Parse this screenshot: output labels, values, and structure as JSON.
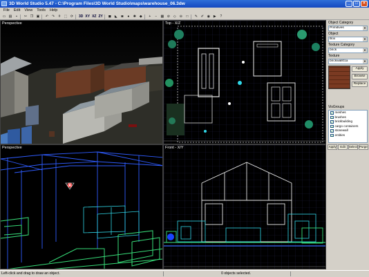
{
  "window": {
    "title": "3D World Studio 5.47 - C:\\Program Files\\3D World Studio\\maps\\warehouse_06.3dw"
  },
  "menu": [
    "File",
    "Edit",
    "View",
    "Tools",
    "Help"
  ],
  "toolbar": {
    "view_labels": [
      "3D",
      "XY",
      "XZ",
      "ZY"
    ]
  },
  "viewports": {
    "top_left_label": "Perspective",
    "top_right_label": "Top - X/Z",
    "bottom_left_label": "Perspective",
    "bottom_right_label": "Front - X/Y"
  },
  "panel": {
    "object_category_label": "Object Category",
    "object_category_value": "Primitives",
    "object_label": "Object",
    "object_value": "Box",
    "texture_category_label": "Texture Category",
    "texture_category_value": "brick",
    "texture_label": "Texture",
    "texture_value": "brickwall01a",
    "apply_label": "Apply",
    "browse_label": "Browse",
    "replace_label": "Replace",
    "visgroups_label": "VisGroups",
    "visgroups": [
      "meshes",
      "brushes",
      "brickbuilding",
      "cargo containers",
      "stonewall",
      "entities"
    ],
    "vis_buttons": [
      "Apply",
      "Edit",
      "Select",
      "Purge"
    ]
  },
  "status": {
    "left": "Left-click and drag to draw an object.",
    "middle": "0 objects selected."
  },
  "colors": {
    "title_bar": "#1f5bd0",
    "wire_green": "#38e07a",
    "wire_blue": "#3a6cff",
    "wire_cyan": "#30d8e8"
  }
}
